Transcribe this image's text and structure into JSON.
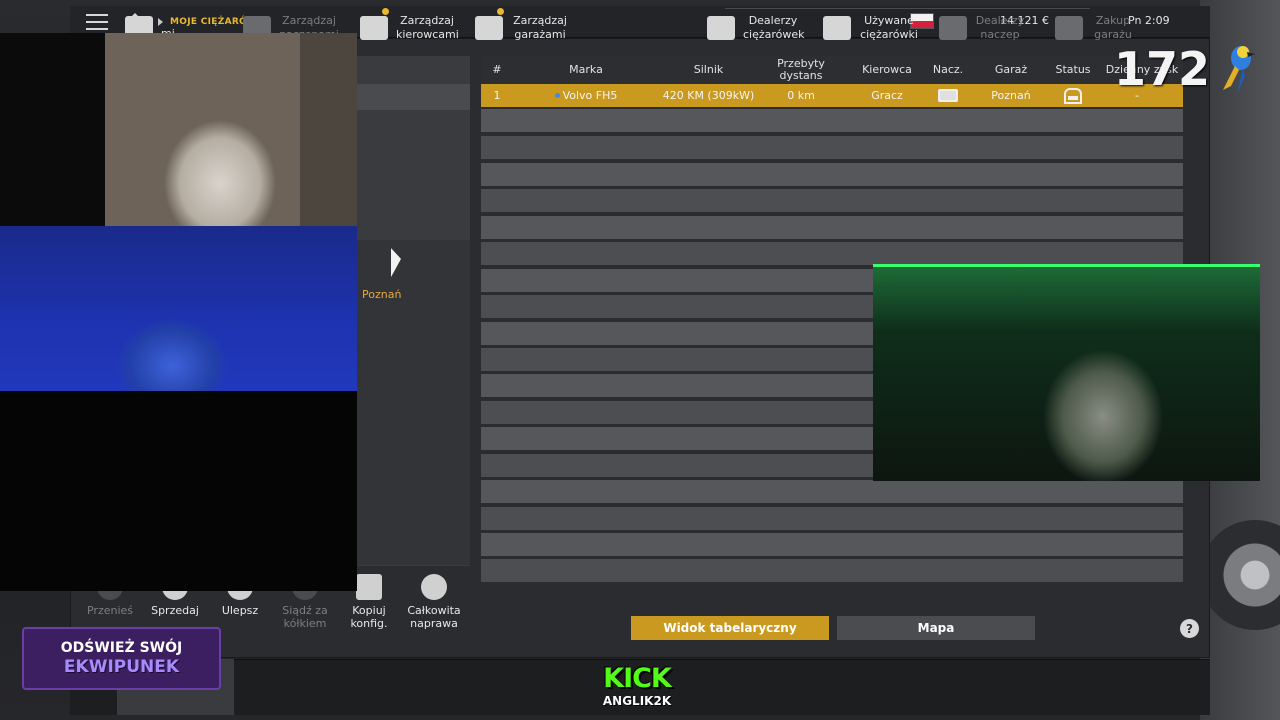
{
  "topbar": {
    "breadcrumb": "MOJE CIĘŻARÓWKI",
    "money": "14 121 €",
    "time": "Pn 2:09"
  },
  "sidebar": {
    "garage_label": "Poznań"
  },
  "table": {
    "columns": [
      "#",
      "Marka",
      "Silnik",
      "Przebyty dystans",
      "Kierowca",
      "Nacz.",
      "Garaż",
      "Status",
      "Dzienny zysk"
    ],
    "rows": [
      {
        "num": "1",
        "brand": "Volvo FH5",
        "engine": "420 KM (309kW)",
        "distance": "0 km",
        "driver": "Gracz",
        "trailer_icon": "trailer-icon",
        "garage": "Poznań",
        "status_icon": "garage-icon",
        "profit": "-"
      }
    ]
  },
  "actions": [
    {
      "label": "Przenieś",
      "icon": "move-icon",
      "enabled": false
    },
    {
      "label": "Sprzedaj",
      "icon": "sell-icon",
      "enabled": true
    },
    {
      "label": "Ulepsz",
      "icon": "upgrade-icon",
      "enabled": true
    },
    {
      "label": "Siądź za kółkiem",
      "icon": "steering-wheel-icon",
      "enabled": false
    },
    {
      "label": "Kopiuj konfig.",
      "icon": "copy-icon",
      "enabled": true
    },
    {
      "label": "Całkowita naprawa",
      "icon": "repair-icon",
      "enabled": true
    }
  ],
  "view_buttons": {
    "table": "Widok tabelaryczny",
    "map": "Mapa",
    "help": "?"
  },
  "bottom_nav": [
    {
      "label": "mi",
      "icon": "truck-icon",
      "enabled": true
    },
    {
      "label": "Zarządzaj naczepami",
      "icon": "trailer-manage-icon",
      "enabled": false
    },
    {
      "label": "Zarządzaj kierowcami",
      "icon": "driver-icon",
      "enabled": true
    },
    {
      "label": "Zarządzaj garażami",
      "icon": "garage-manage-icon",
      "enabled": true
    },
    {
      "label": "Dealerzy ciężarówek",
      "icon": "truck-dealer-icon",
      "enabled": true
    },
    {
      "label": "Używane ciężarówki",
      "icon": "used-truck-icon",
      "enabled": true
    },
    {
      "label": "Dealerzy naczep",
      "icon": "trailer-dealer-icon",
      "enabled": false
    },
    {
      "label": "Zakup garażu",
      "icon": "buy-garage-icon",
      "enabled": false
    }
  ],
  "overlays": {
    "counter": "172",
    "kick_logo": "KICK",
    "kick_channel": "ANGLIK2K",
    "promo_line1": "ODŚWIEŻ SWÓJ",
    "promo_line2": "EKWIPUNEK"
  },
  "colors": {
    "accent": "#c99a1f",
    "breadcrumb": "#e8b830",
    "kick": "#53fc18"
  }
}
